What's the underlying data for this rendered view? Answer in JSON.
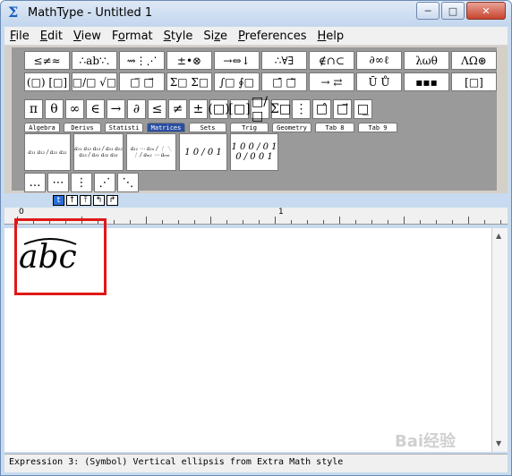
{
  "window": {
    "title": "MathType - Untitled 1",
    "app_icon": "sigma-icon",
    "buttons": {
      "minimize": "─",
      "maximize": "□",
      "close": "✕"
    }
  },
  "menu": [
    {
      "label": "File",
      "accel": "F"
    },
    {
      "label": "Edit",
      "accel": "E"
    },
    {
      "label": "View",
      "accel": "V"
    },
    {
      "label": "Format",
      "accel": "o"
    },
    {
      "label": "Style",
      "accel": "S"
    },
    {
      "label": "Size",
      "accel": "z"
    },
    {
      "label": "Preferences",
      "accel": "P"
    },
    {
      "label": "Help",
      "accel": "H"
    }
  ],
  "palette_row1": [
    "≤≠≈",
    "∴ab∵.",
    "⇝⋮⋰",
    "±•⊗",
    "→⇔↓",
    "∴∀∃",
    "∉∩⊂",
    "∂∞ℓ",
    "λωθ",
    "ΛΩ⊛"
  ],
  "palette_row2": [
    "(□) [□]",
    "□/□ √□",
    "□̅ □⃗",
    "Σ□ Σ□",
    "∫□ ∮□",
    "□̄ □⃖",
    "→ ⇄",
    "Ū Ů",
    "▪▪▪",
    "[□]"
  ],
  "symbol_bar": [
    "π",
    "θ",
    "∞",
    "∈",
    "→",
    "∂",
    "≤",
    "≠",
    "±",
    "(□)",
    "[□]",
    "□/□",
    "Σ□",
    "⋮",
    "□̂",
    "□⃗",
    "□̲"
  ],
  "tabs": [
    {
      "label": "Algebra",
      "active": false
    },
    {
      "label": "Derivs",
      "active": false
    },
    {
      "label": "Statisti",
      "active": false
    },
    {
      "label": "Matrices",
      "active": true
    },
    {
      "label": "Sets",
      "active": false
    },
    {
      "label": "Trig",
      "active": false
    },
    {
      "label": "Geometry",
      "active": false
    },
    {
      "label": "Tab 8",
      "active": false
    },
    {
      "label": "Tab 9",
      "active": false
    }
  ],
  "matrix_templates": [
    {
      "name": "matrix-2x2-template",
      "text": "a₁₁ a₁₂ / a₂₁ a₂₂"
    },
    {
      "name": "matrix-3x3-template",
      "text": "a₁₁ a₁₂ a₁₃ / a₂₁ a₂₂ a₂₃ / a₃₁ a₃₂ a₃₃"
    },
    {
      "name": "matrix-mxn-template",
      "text": "a₁₁ ⋯ a₁ₙ / ⋮ ⋱ ⋮ / aₘ₁ ⋯ aₘₙ"
    },
    {
      "name": "identity-2x2-template",
      "text": "1 0 / 0 1"
    },
    {
      "name": "identity-3x3-template",
      "text": "1 0 0 / 0 1 0 / 0 0 1"
    }
  ],
  "ellipsis_bar": [
    "…",
    "⋯",
    "⋮",
    "⋰",
    "⋱"
  ],
  "size_buttons": [
    "t",
    "↑",
    "⤒",
    "↰",
    "↱"
  ],
  "ruler": {
    "mark_0": "0",
    "mark_1": "1"
  },
  "editor": {
    "expression": "abc"
  },
  "status": {
    "text": "Expression 3:  (Symbol) Vertical ellipsis from Extra Math style"
  },
  "watermark": "Bai经验"
}
